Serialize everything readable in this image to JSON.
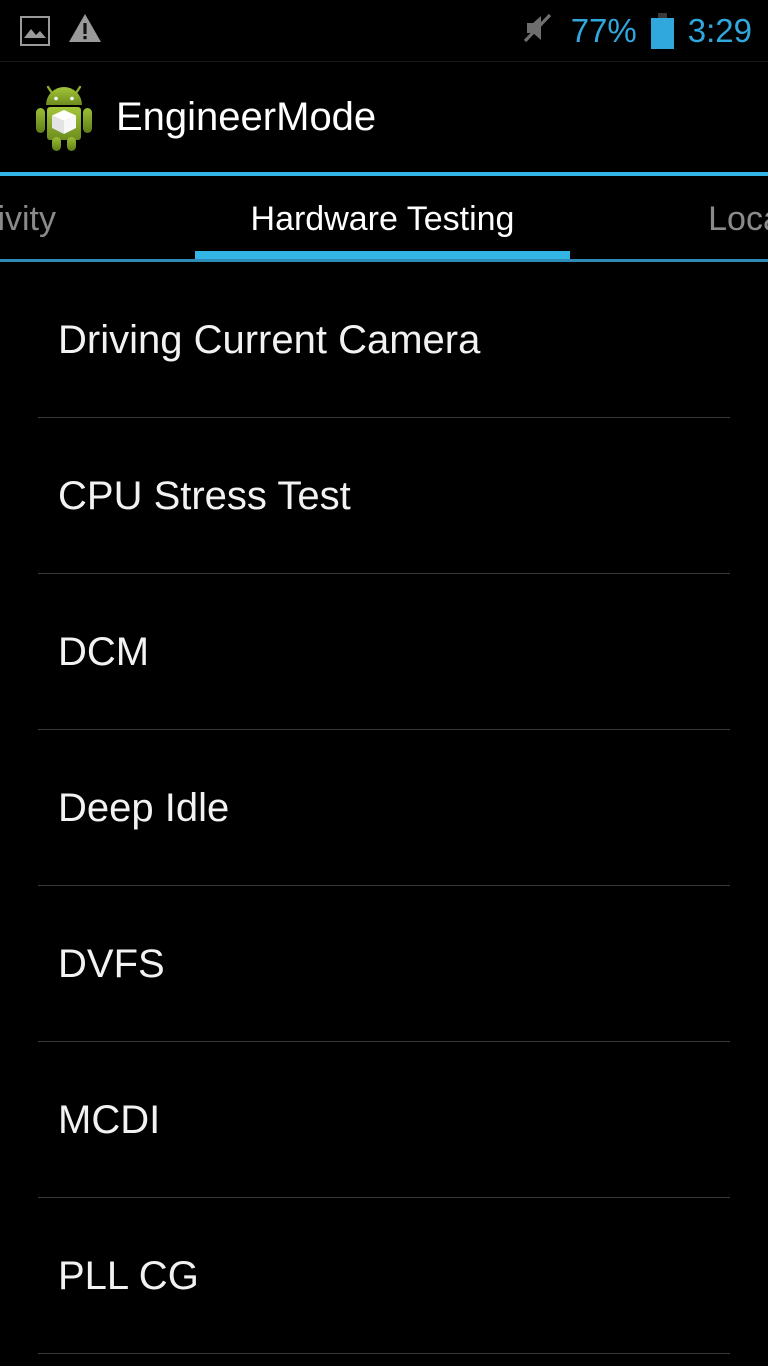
{
  "status_bar": {
    "icons_left": [
      {
        "name": "screenshot-image-icon",
        "label": "image"
      },
      {
        "name": "warning-triangle-icon",
        "label": "warning"
      }
    ],
    "icons_right": [
      {
        "name": "volume-mute-icon",
        "label": "silent"
      }
    ],
    "battery_percent": "77%",
    "battery_icon_name": "battery-icon",
    "time": "3:29",
    "accent_color": "#30a8dd"
  },
  "action_bar": {
    "app_icon_name": "android-engineermode-icon",
    "title": "EngineerMode"
  },
  "tabs": {
    "accent_color": "#33b5e5",
    "items": [
      {
        "label": "tivity",
        "full_label": "Connectivity",
        "active": false
      },
      {
        "label": "Hardware Testing",
        "full_label": "Hardware Testing",
        "active": true
      },
      {
        "label": "Loca",
        "full_label": "Location",
        "active": false
      }
    ]
  },
  "list": {
    "items": [
      {
        "label": "Driving Current Camera"
      },
      {
        "label": "CPU Stress Test"
      },
      {
        "label": "DCM"
      },
      {
        "label": "Deep Idle"
      },
      {
        "label": "DVFS"
      },
      {
        "label": "MCDI"
      },
      {
        "label": "PLL CG"
      }
    ]
  }
}
